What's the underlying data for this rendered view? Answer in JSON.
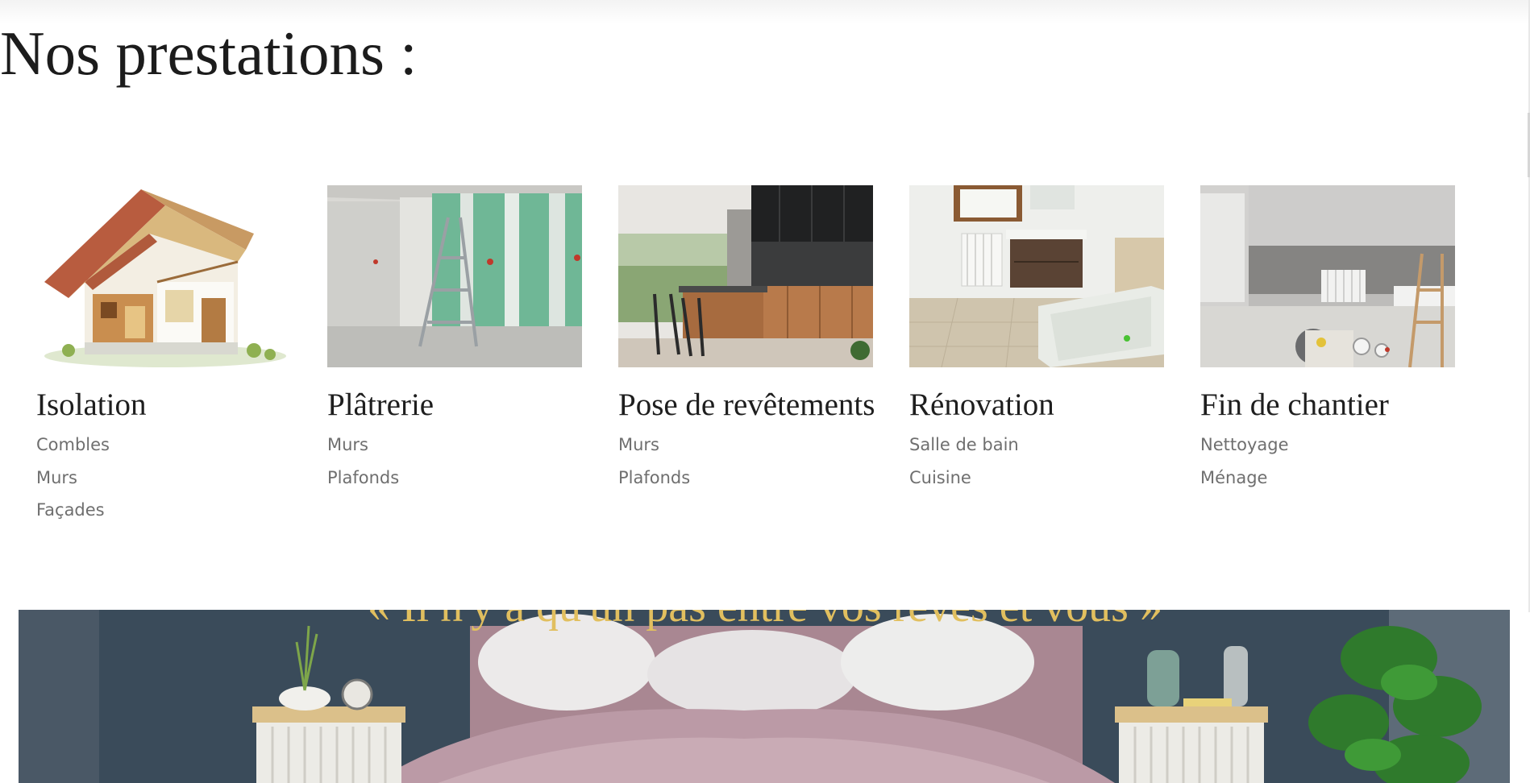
{
  "section": {
    "title": "Nos prestations :"
  },
  "services": [
    {
      "title": "Isolation",
      "items": [
        "Combles",
        "Murs",
        "Façades"
      ]
    },
    {
      "title": "Plâtrerie",
      "items": [
        "Murs",
        "Plafonds"
      ]
    },
    {
      "title": "Pose de revêtements",
      "items": [
        "Murs",
        "Plafonds"
      ]
    },
    {
      "title": "Rénovation",
      "items": [
        "Salle de bain",
        "Cuisine"
      ]
    },
    {
      "title": "Fin de chantier",
      "items": [
        "Nettoyage",
        "Ménage"
      ]
    }
  ],
  "banner": {
    "quote": "« Il n'y a qu'un pas entre vos rêves et vous »"
  },
  "colors": {
    "title_text": "#1c1c1c",
    "item_text": "#6f6f6f",
    "quote_gold": "#e1bf5f",
    "banner_wall": "#394a59"
  }
}
